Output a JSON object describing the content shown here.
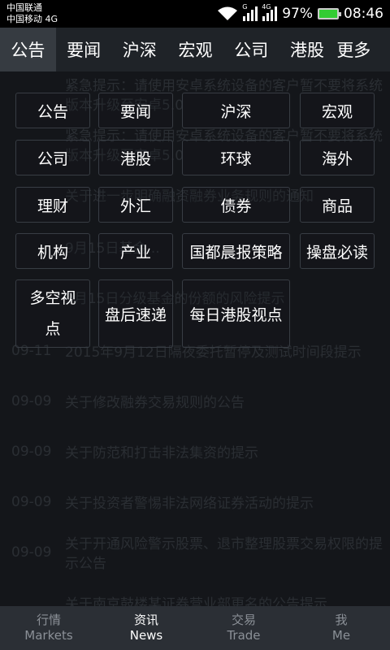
{
  "status": {
    "carrier1": "中国联通",
    "carrier2": "中国移动 4G",
    "net1": "G",
    "net2": "4G",
    "battery": "97%",
    "time": "08:46"
  },
  "tabs": [
    "公告",
    "要闻",
    "沪深",
    "宏观",
    "公司",
    "港股",
    "更多"
  ],
  "background_news": [
    {
      "date": "",
      "title": "紧急提示：请使用安卓系统设备的客户暂不要将系统版本升级至安卓5.0"
    },
    {
      "date": "",
      "title": "紧急提示：请使用安卓系统设备的客户暂不要将系统版本升级至安卓5.0"
    },
    {
      "date": "",
      "title": "关于进一步明确融资融券业务规则的通知"
    },
    {
      "date": "",
      "title": "9月15日基金..."
    },
    {
      "date": "",
      "title": "9月15日分级基金的份额的风险提示"
    },
    {
      "date": "09-11",
      "title": "2015年9月12日隔夜委托暂停及测试时间段提示"
    },
    {
      "date": "09-09",
      "title": "关于修改融券交易规则的公告"
    },
    {
      "date": "09-09",
      "title": "关于防范和打击非法集资的提示"
    },
    {
      "date": "09-09",
      "title": "关于投资者警惕非法网络证券活动的提示"
    },
    {
      "date": "09-09",
      "title": "关于开通风险警示股票、退市整理股票交易权限的提示公告"
    },
    {
      "date": "",
      "title": "关于南京鼓楼某证券营业部更名的公告提示"
    }
  ],
  "categories": [
    "公告",
    "要闻",
    "沪深",
    "宏观",
    "公司",
    "港股",
    "环球",
    "海外",
    "理财",
    "外汇",
    "债券",
    "商品",
    "机构",
    "产业",
    "国都晨报策略",
    "操盘必读",
    "多空视点",
    "盘后速递",
    "每日港股视点"
  ],
  "bottom_nav": [
    {
      "cn": "行情",
      "en": "Markets"
    },
    {
      "cn": "资讯",
      "en": "News"
    },
    {
      "cn": "交易",
      "en": "Trade"
    },
    {
      "cn": "我",
      "en": "Me"
    }
  ],
  "colors": {
    "active_tab_bg": "#363b41",
    "tabbar_bg": "#1f2328",
    "bottom_nav_bg": "#2b2f35",
    "battery_green": "#33cc33"
  }
}
